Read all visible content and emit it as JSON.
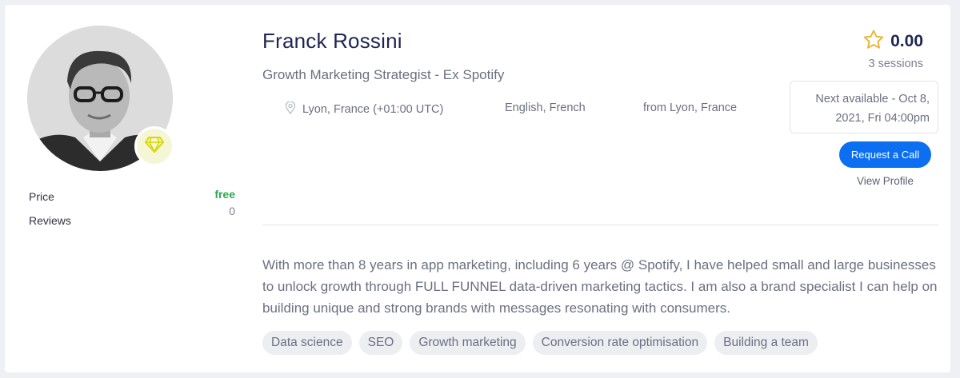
{
  "profile": {
    "name": "Franck Rossini",
    "headline": "Growth Marketing Strategist - Ex Spotify",
    "location": "Lyon, France (+01:00 UTC)",
    "languages": "English, French",
    "origin": "from Lyon, France"
  },
  "stats": {
    "price_label": "Price",
    "price_value": "free",
    "reviews_label": "Reviews",
    "reviews_value": "0"
  },
  "rating": {
    "value": "0.00",
    "sessions": "3 sessions",
    "star_color": "#e9b83a"
  },
  "availability": {
    "text": "Next available - Oct 8, 2021, Fri 04:00pm"
  },
  "actions": {
    "request_call": "Request a Call",
    "view_profile": "View Profile"
  },
  "bio": "With more than 8 years in app marketing, including 6 years @ Spotify, I have helped small and large businesses to unlock growth through FULL FUNNEL data-driven marketing tactics. I am also a brand specialist I can help on building unique and strong brands with messages resonating with consumers.",
  "tags": [
    "Data science",
    "SEO",
    "Growth marketing",
    "Conversion rate optimisation",
    "Building a team"
  ],
  "icons": {
    "badge": "diamond-icon",
    "location": "map-pin-icon",
    "rating": "star-icon"
  },
  "colors": {
    "accent": "#0c6ef0",
    "name": "#1f2552",
    "free": "#2fa84f",
    "badge_bg": "#f5f6d5",
    "diamond": "#d7d800"
  }
}
